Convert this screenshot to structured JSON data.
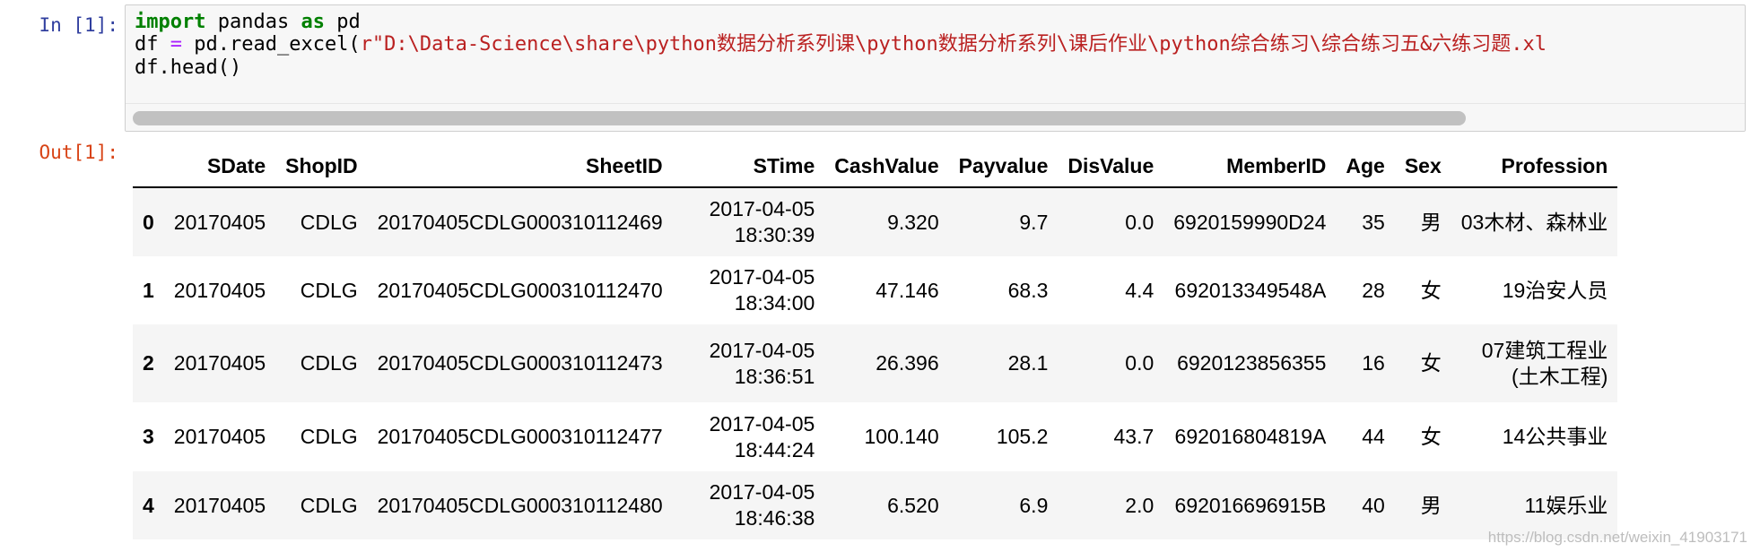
{
  "cell": {
    "in_prompt": "In [1]:",
    "out_prompt": "Out[1]:",
    "code": {
      "line1": {
        "kw_import": "import",
        "module": " pandas ",
        "kw_as": "as",
        "alias": " pd"
      },
      "line2": {
        "lhs": "df ",
        "op": "=",
        "call": " pd.read_excel(",
        "arg": "r\"D:\\Data-Science\\share\\python数据分析系列课\\python数据分析系列\\课后作业\\python综合练习\\综合练习五&六练习题.xl"
      },
      "line3": "df.head()"
    }
  },
  "dataframe": {
    "columns": [
      "",
      "SDate",
      "ShopID",
      "SheetID",
      "STime",
      "CashValue",
      "Payvalue",
      "DisValue",
      "MemberID",
      "Age",
      "Sex",
      "Profession"
    ],
    "rows": [
      {
        "index": "0",
        "SDate": "20170405",
        "ShopID": "CDLG",
        "SheetID": "20170405CDLG000310112469",
        "STime_date": "2017-04-05",
        "STime_time": "18:30:39",
        "CashValue": "9.320",
        "Payvalue": "9.7",
        "DisValue": "0.0",
        "MemberID": "6920159990D24",
        "Age": "35",
        "Sex": "男",
        "Profession_1": "03木材、森林业",
        "Profession_2": ""
      },
      {
        "index": "1",
        "SDate": "20170405",
        "ShopID": "CDLG",
        "SheetID": "20170405CDLG000310112470",
        "STime_date": "2017-04-05",
        "STime_time": "18:34:00",
        "CashValue": "47.146",
        "Payvalue": "68.3",
        "DisValue": "4.4",
        "MemberID": "692013349548A",
        "Age": "28",
        "Sex": "女",
        "Profession_1": "19治安人员",
        "Profession_2": ""
      },
      {
        "index": "2",
        "SDate": "20170405",
        "ShopID": "CDLG",
        "SheetID": "20170405CDLG000310112473",
        "STime_date": "2017-04-05",
        "STime_time": "18:36:51",
        "CashValue": "26.396",
        "Payvalue": "28.1",
        "DisValue": "0.0",
        "MemberID": "6920123856355",
        "Age": "16",
        "Sex": "女",
        "Profession_1": "07建筑工程业",
        "Profession_2": "(土木工程)"
      },
      {
        "index": "3",
        "SDate": "20170405",
        "ShopID": "CDLG",
        "SheetID": "20170405CDLG000310112477",
        "STime_date": "2017-04-05",
        "STime_time": "18:44:24",
        "CashValue": "100.140",
        "Payvalue": "105.2",
        "DisValue": "43.7",
        "MemberID": "692016804819A",
        "Age": "44",
        "Sex": "女",
        "Profession_1": "14公共事业",
        "Profession_2": ""
      },
      {
        "index": "4",
        "SDate": "20170405",
        "ShopID": "CDLG",
        "SheetID": "20170405CDLG000310112480",
        "STime_date": "2017-04-05",
        "STime_time": "18:46:38",
        "CashValue": "6.520",
        "Payvalue": "6.9",
        "DisValue": "2.0",
        "MemberID": "692016696915B",
        "Age": "40",
        "Sex": "男",
        "Profession_1": "11娱乐业",
        "Profession_2": ""
      }
    ]
  },
  "watermark": "https://blog.csdn.net/weixin_41903171",
  "colors": {
    "in_prompt": "#303f9f",
    "out_prompt": "#d84315",
    "keyword": "#008000",
    "operator": "#aa22ff",
    "string": "#ba2121",
    "stripe": "#f5f5f5"
  }
}
